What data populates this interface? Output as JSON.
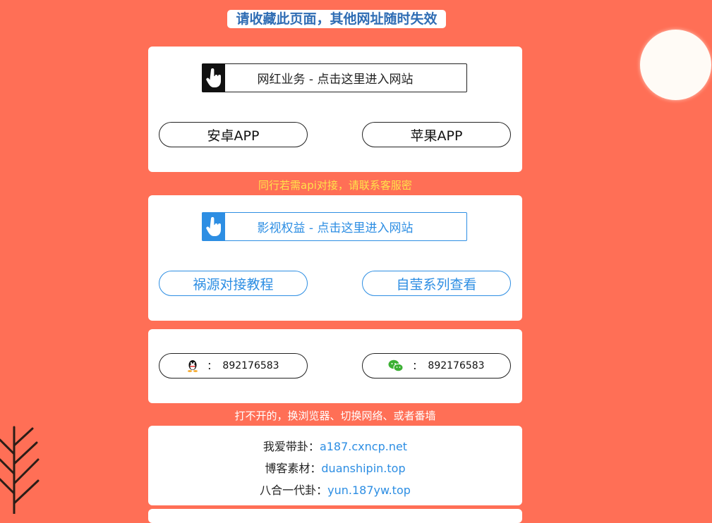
{
  "header": {
    "title": "请收藏此页面，其他网址随时失效"
  },
  "card1": {
    "site_button": "网红业务 - 点击这里进入网站",
    "android_button": "安卓APP",
    "ios_button": "苹果APP"
  },
  "notice_api": "同行若需api对接，请联系客服密",
  "card2": {
    "site_button": "影视权益 - 点击这里进入网站",
    "guide_button": "祸源对接教程",
    "series_button": "自莹系列查看"
  },
  "contact": {
    "qq_sep": "：",
    "qq_number": "892176583",
    "wechat_sep": "：",
    "wechat_number": "892176583"
  },
  "notice_open": "打不开的，换浏览器、切换网络、或者番墙",
  "links": [
    {
      "label": "我爱带卦：",
      "url": "a187.cxncp.net"
    },
    {
      "label": "博客素材：",
      "url": "duanshipin.top"
    },
    {
      "label": "八合一代卦：",
      "url": "yun.187yw.top"
    }
  ],
  "colors": {
    "background": "#ff6f56",
    "accent_blue": "#2d8ee3",
    "notice_yellow": "#ffe24a",
    "title_blue": "#2f6db4"
  }
}
